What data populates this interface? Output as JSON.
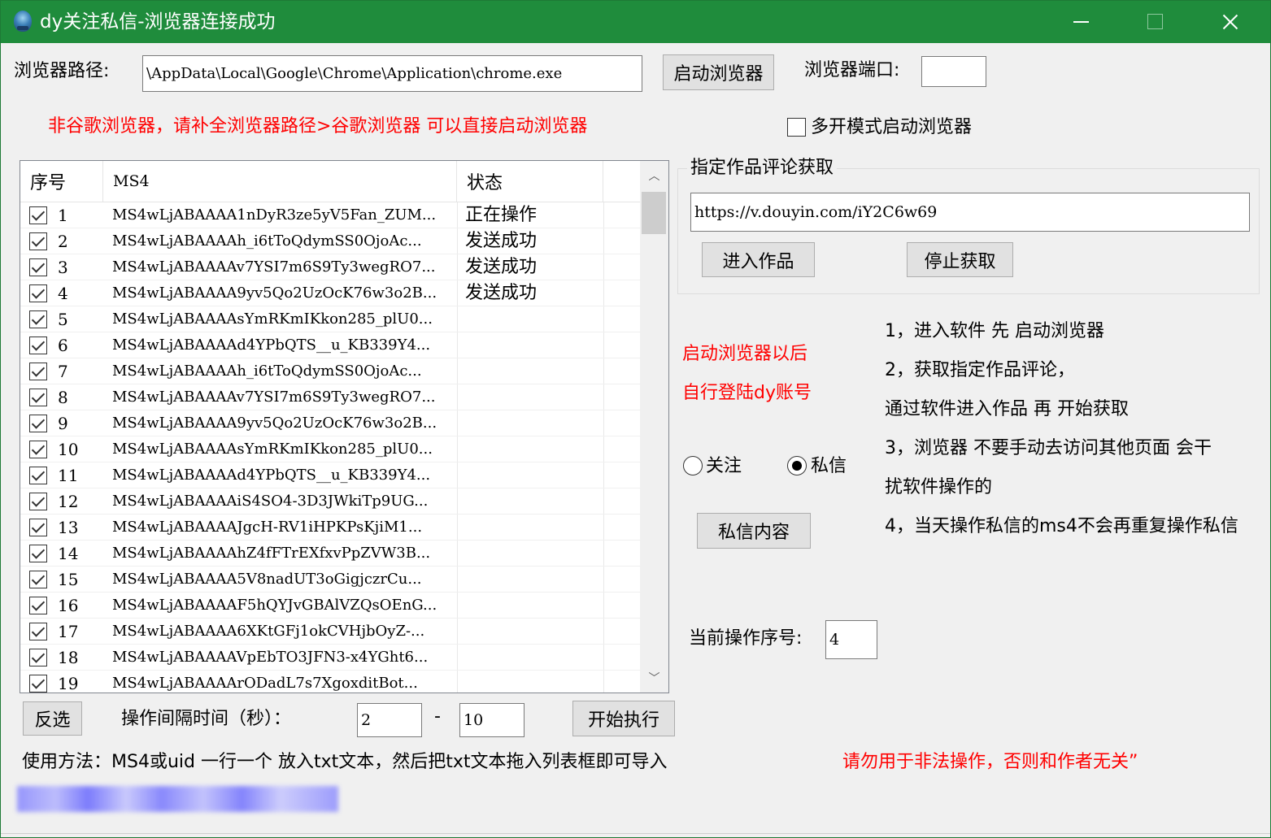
{
  "window": {
    "title": "dy关注私信-浏览器连接成功",
    "title_bar_color": "#1f8c3c"
  },
  "browser": {
    "path_label": "浏览器路径:",
    "path_value": "\\AppData\\Local\\Google\\Chrome\\Application\\chrome.exe",
    "launch_button": "启动浏览器",
    "port_label": "浏览器端口:",
    "port_value": "",
    "hint": "非谷歌浏览器，请补全浏览器路径>谷歌浏览器 可以直接启动浏览器",
    "multi_open_label": "多开模式启动浏览器",
    "multi_open_checked": false
  },
  "list": {
    "columns": [
      "序号",
      "MS4",
      "状态"
    ],
    "rows": [
      {
        "num": "1",
        "ms4": "MS4wLjABAAAA1nDyR3ze5yV5Fan_ZUM...",
        "status": "正在操作",
        "checked": true
      },
      {
        "num": "2",
        "ms4": "MS4wLjABAAAAh_i6tToQdymSS0OjoAc...",
        "status": "发送成功",
        "checked": true
      },
      {
        "num": "3",
        "ms4": "MS4wLjABAAAAv7YSI7m6S9Ty3wegRO7...",
        "status": "发送成功",
        "checked": true
      },
      {
        "num": "4",
        "ms4": "MS4wLjABAAAA9yv5Qo2UzOcK76w3o2B...",
        "status": "发送成功",
        "checked": true
      },
      {
        "num": "5",
        "ms4": "MS4wLjABAAAAsYmRKmIKkon285_plU0...",
        "status": "",
        "checked": true
      },
      {
        "num": "6",
        "ms4": "MS4wLjABAAAAd4YPbQTS__u_KB339Y4...",
        "status": "",
        "checked": true
      },
      {
        "num": "7",
        "ms4": "MS4wLjABAAAAh_i6tToQdymSS0OjoAc...",
        "status": "",
        "checked": true
      },
      {
        "num": "8",
        "ms4": "MS4wLjABAAAAv7YSI7m6S9Ty3wegRO7...",
        "status": "",
        "checked": true
      },
      {
        "num": "9",
        "ms4": "MS4wLjABAAAA9yv5Qo2UzOcK76w3o2B...",
        "status": "",
        "checked": true
      },
      {
        "num": "10",
        "ms4": "MS4wLjABAAAAsYmRKmIKkon285_plU0...",
        "status": "",
        "checked": true
      },
      {
        "num": "11",
        "ms4": "MS4wLjABAAAAd4YPbQTS__u_KB339Y4...",
        "status": "",
        "checked": true
      },
      {
        "num": "12",
        "ms4": "MS4wLjABAAAAiS4SO4-3D3JWkiTp9UG...",
        "status": "",
        "checked": true
      },
      {
        "num": "13",
        "ms4": "MS4wLjABAAAAJgcH-RV1iHPKPsKjiM1...",
        "status": "",
        "checked": true
      },
      {
        "num": "14",
        "ms4": "MS4wLjABAAAAhZ4fFTrEXfxvPpZVW3B...",
        "status": "",
        "checked": true
      },
      {
        "num": "15",
        "ms4": "MS4wLjABAAAA5V8nadUT3oGigjczrCu...",
        "status": "",
        "checked": true
      },
      {
        "num": "16",
        "ms4": "MS4wLjABAAAAF5hQYJvGBAlVZQsOEnG...",
        "status": "",
        "checked": true
      },
      {
        "num": "17",
        "ms4": "MS4wLjABAAAA6XKtGFj1okCVHjbOyZ-...",
        "status": "",
        "checked": true
      },
      {
        "num": "18",
        "ms4": "MS4wLjABAAAAVpEbTO3JFN3-x4YGht6...",
        "status": "",
        "checked": true
      },
      {
        "num": "19",
        "ms4": "MS4wLjABAAAArODadL7s7XgoxditBot...",
        "status": "",
        "checked": true
      }
    ]
  },
  "work": {
    "group_title": "指定作品评论获取",
    "url_value": "https://v.douyin.com/iY2C6w69",
    "enter_button": "进入作品",
    "stop_button": "停止获取"
  },
  "notes": {
    "red_line1": "启动浏览器以后",
    "red_line2": "自行登陆dy账号",
    "steps": [
      "1，进入软件 先 启动浏览器",
      "2，获取指定作品评论，",
      "通过软件进入作品 再 开始获取",
      "3，浏览器 不要手动去访问其他页面 会干",
      "扰软件操作的",
      "4，当天操作私信的ms4不会再重复操作私信"
    ]
  },
  "mode": {
    "follow_label": "关注",
    "message_label": "私信",
    "selected": "私信",
    "message_content_button": "私信内容"
  },
  "current": {
    "label": "当前操作序号:",
    "value": "4"
  },
  "controls": {
    "invert_button": "反选",
    "interval_label": "操作间隔时间（秒）：",
    "interval_min": "2",
    "interval_sep": "-",
    "interval_max": "10",
    "start_button": "开始执行"
  },
  "footer": {
    "usage": "使用方法：MS4或uid 一行一个 放入txt文本，然后把txt文本拖入列表框即可导入",
    "warning": "请勿用于非法操作，否则和作者无关”",
    "blurred_link": "[blurred link text]"
  }
}
